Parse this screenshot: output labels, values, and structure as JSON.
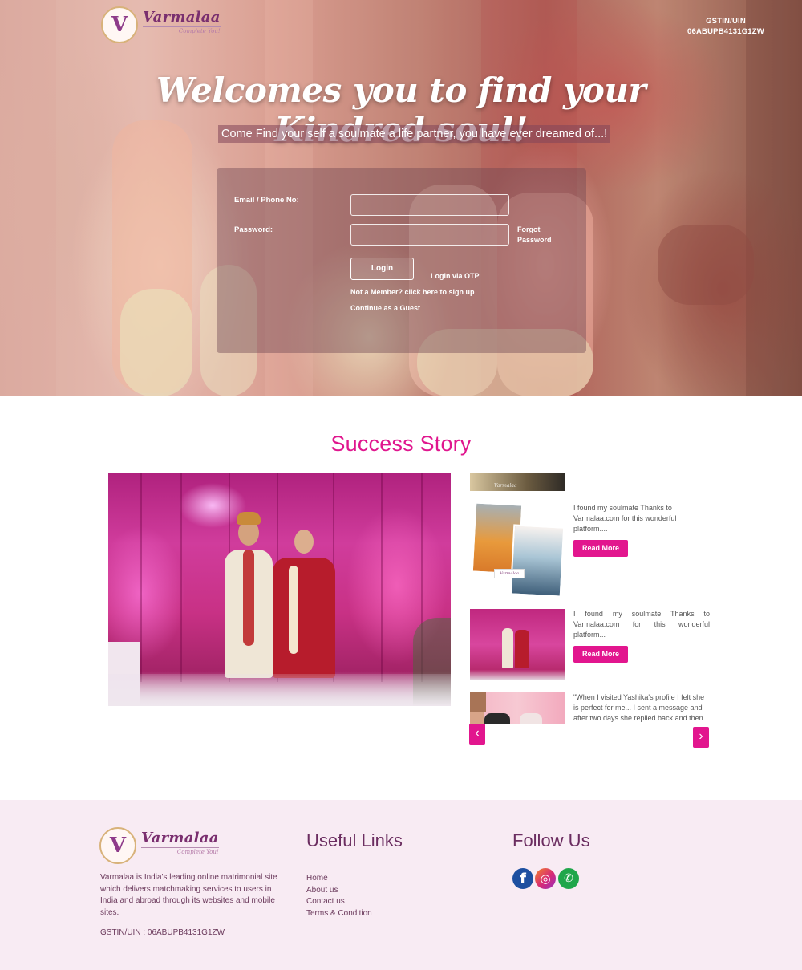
{
  "brand": {
    "name": "Varmalaa",
    "tagline": "Complete You!",
    "logo_letter": "V"
  },
  "header": {
    "gstin_label": "GSTIN/UIN",
    "gstin_value": "06ABUPB4131G1ZW"
  },
  "hero": {
    "title": "Welcomes you to find your Kindred soul!",
    "subtitle": "Come Find your self a soulmate a life partner, you have ever dreamed of...!"
  },
  "login": {
    "email_label": "Email / Phone No:",
    "email_value": "",
    "password_label": "Password:",
    "password_value": "",
    "forgot": "Forgot Password",
    "login_button": "Login",
    "otp": "Login via OTP",
    "signup": "Not a Member? click here to sign up",
    "guest": "Continue as a Guest"
  },
  "success": {
    "title": "Success Story",
    "stories": [
      {
        "text": "I found my soulmate Thanks to Varmalaa.com for this wonderful platform....",
        "read_more": "Read More"
      },
      {
        "text": "I found my soulmate Thanks to Varmalaa.com for this wonderful platform...",
        "read_more": "Read More"
      },
      {
        "text": "\"When I visited Yashika's profile I felt she is perfect for me... I sent a message and after two days she replied back and then"
      }
    ],
    "thumb_watermark": "Varmalaa",
    "thumb_logo_text": "Varmalaa",
    "prev_icon": "‹",
    "next_icon": "›"
  },
  "footer": {
    "about": "Varmalaa is India's leading online matrimonial site which delivers matchmaking services to users in India and abroad through its websites and mobile sites.",
    "gstin": "GSTIN/UIN : 06ABUPB4131G1ZW",
    "useful_links_title": "Useful Links",
    "links": [
      "Home",
      "About us",
      "Contact us",
      "Terms & Condition"
    ],
    "follow_title": "Follow Us",
    "social": [
      {
        "icon": "facebook-icon",
        "glyph": "f",
        "color": "#1d4fa0"
      },
      {
        "icon": "instagram-icon",
        "glyph": "◎",
        "color": "#d62976"
      },
      {
        "icon": "whatsapp-icon",
        "glyph": "✆",
        "color": "#1fa64a"
      }
    ]
  },
  "colors": {
    "accent": "#e2168e",
    "footer_bg": "#f8ebf3",
    "footer_heading": "#6b2d60"
  }
}
